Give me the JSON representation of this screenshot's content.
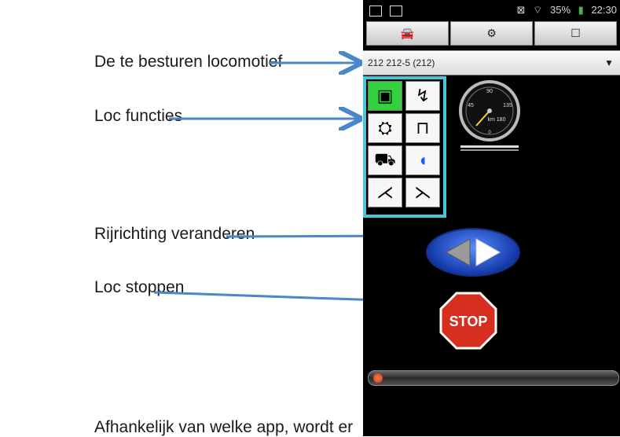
{
  "annotations": {
    "loco": "De te besturen locomotief",
    "functions": "Loc functies",
    "direction": "Rijrichting veranderen",
    "stop": "Loc stoppen",
    "bottom_text": "Afhankelijk van welke app, wordt er"
  },
  "status_bar": {
    "signal": "35%",
    "time": "22:30"
  },
  "locomotive_selector": {
    "value": "212 212-5 (212)",
    "dropdown_glyph": "▼"
  },
  "speedometer": {
    "labels": [
      "90",
      "45",
      "135",
      "km 180",
      "0"
    ],
    "needle_value": 45
  },
  "stop_button": {
    "label": "STOP"
  },
  "speed_slider": {
    "value": 0.0
  },
  "colors": {
    "highlight_border": "#45c7d8",
    "arrow": "#4a86c8",
    "active_function": "#34d13e",
    "direction_button": "#1f4bd1",
    "stop_red": "#d62e1f"
  }
}
